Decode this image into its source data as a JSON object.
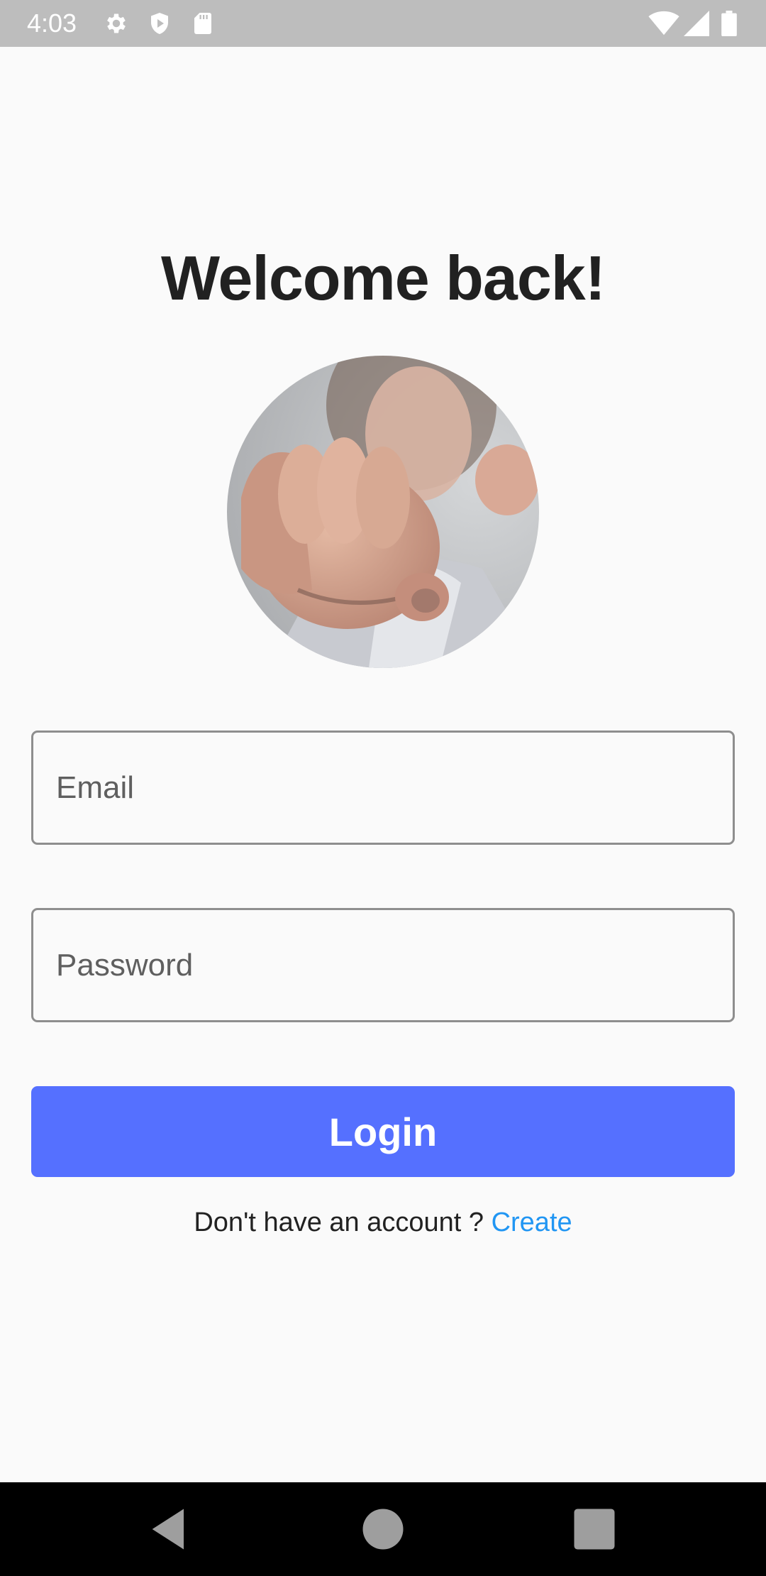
{
  "status_bar": {
    "time": "4:03",
    "icons": [
      "gear-icon",
      "shield-icon",
      "sd-card-icon",
      "wifi-icon",
      "signal-icon",
      "battery-icon"
    ]
  },
  "login": {
    "title": "Welcome back!",
    "avatar": "profile-photo",
    "email_placeholder": "Email",
    "password_placeholder": "Password",
    "login_label": "Login",
    "signup_prompt": "Don't have an account ? ",
    "signup_link": "Create"
  },
  "nav_bar": {
    "buttons": [
      "back-icon",
      "home-icon",
      "recents-icon"
    ]
  },
  "colors": {
    "accent": "#5570ff",
    "link": "#2196f3",
    "status_bar": "#bdbdbd",
    "background": "#fafafa"
  }
}
